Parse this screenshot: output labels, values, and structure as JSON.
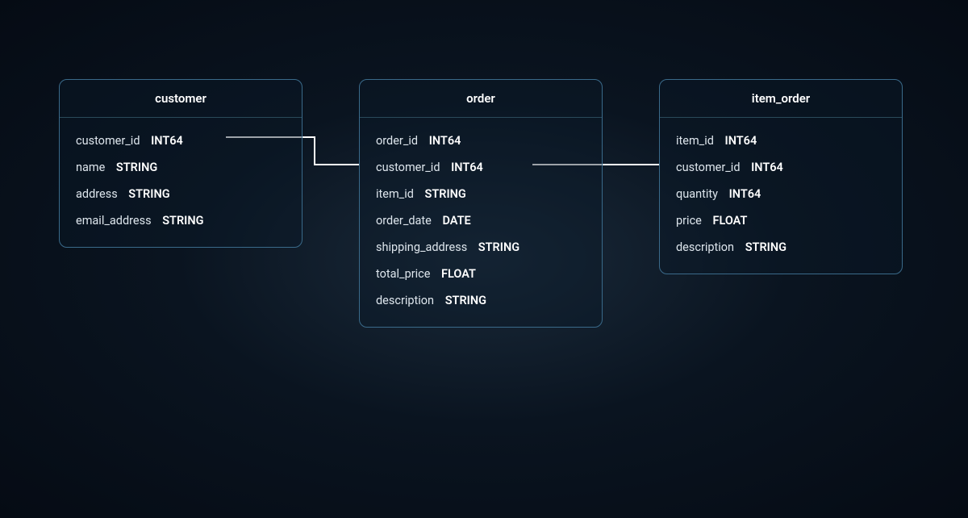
{
  "entities": {
    "customer": {
      "title": "customer",
      "columns": [
        {
          "name": "customer_id",
          "type": "INT64"
        },
        {
          "name": "name",
          "type": "STRING"
        },
        {
          "name": "address",
          "type": "STRING"
        },
        {
          "name": "email_address",
          "type": "STRING"
        }
      ]
    },
    "order": {
      "title": "order",
      "columns": [
        {
          "name": "order_id",
          "type": "INT64"
        },
        {
          "name": "customer_id",
          "type": "INT64"
        },
        {
          "name": "item_id",
          "type": "STRING"
        },
        {
          "name": "order_date",
          "type": "DATE"
        },
        {
          "name": "shipping_address",
          "type": "STRING"
        },
        {
          "name": "total_price",
          "type": "FLOAT"
        },
        {
          "name": "description",
          "type": "STRING"
        }
      ]
    },
    "item_order": {
      "title": "item_order",
      "columns": [
        {
          "name": "item_id",
          "type": "INT64"
        },
        {
          "name": "customer_id",
          "type": "INT64"
        },
        {
          "name": "quantity",
          "type": "INT64"
        },
        {
          "name": "price",
          "type": "FLOAT"
        },
        {
          "name": "description",
          "type": "STRING"
        }
      ]
    }
  },
  "relationships": [
    {
      "from": "customer.customer_id",
      "to": "order.customer_id"
    },
    {
      "from": "order.customer_id",
      "to": "item_order.customer_id"
    }
  ],
  "colors": {
    "border": "#3a6a8a",
    "divider": "#2a4a5a",
    "text": "#dde5ec",
    "connector": "#ffffff",
    "bg_gradient_inner": "#1a2a3a",
    "bg_gradient_outer": "#050b14"
  }
}
